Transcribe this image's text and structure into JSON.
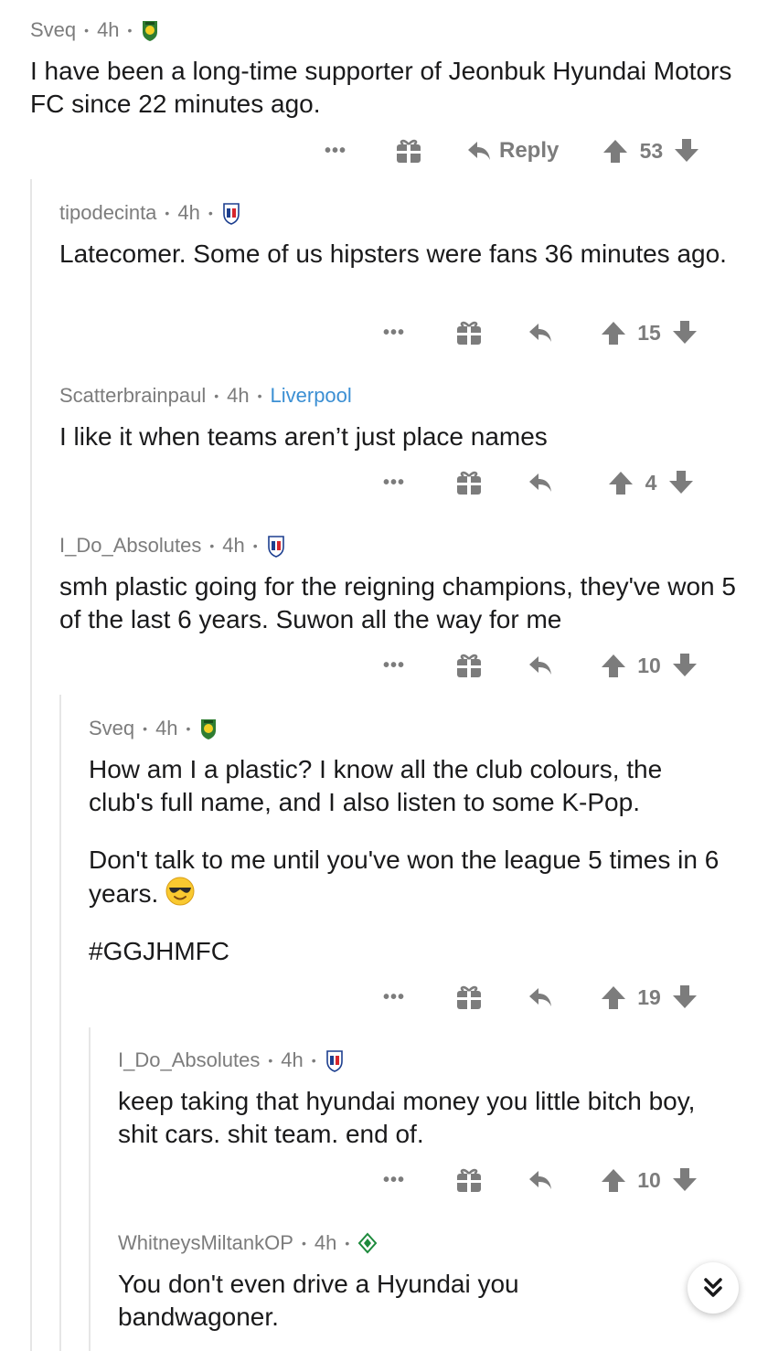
{
  "comments": [
    {
      "author": "Sveq",
      "age": "4h",
      "flair_icon": "jeonbuk-crest-icon",
      "body": [
        "I have been a long-time supporter of Jeonbuk Hyundai Motors FC since 22 minutes ago."
      ],
      "reply_label": "Reply",
      "score": "53"
    },
    {
      "author": "tipodecinta",
      "age": "4h",
      "flair_icon": "suwon-crest-icon",
      "body": [
        "Latecomer. Some of us hipsters were fans 36 minutes ago."
      ],
      "score": "15"
    },
    {
      "author": "Scatterbrainpaul",
      "age": "4h",
      "flair_text": "Liverpool",
      "body": [
        "I like it when teams aren’t just place names"
      ],
      "score": "4"
    },
    {
      "author": "I_Do_Absolutes",
      "age": "4h",
      "flair_icon": "suwon-crest-icon",
      "body": [
        "smh plastic going for the reigning champions, they've won 5 of the last 6 years. Suwon all the way for me"
      ],
      "score": "10"
    },
    {
      "author": "Sveq",
      "age": "4h",
      "flair_icon": "jeonbuk-crest-icon",
      "body": [
        "How am I a plastic? I know all the club colours, the club's full name, and I also listen to some K-Pop.",
        "Don't talk to me until you've won the league 5 times in 6 years.",
        "#GGJHMFC"
      ],
      "emoji": "sunglasses-emoji",
      "score": "19"
    },
    {
      "author": "I_Do_Absolutes",
      "age": "4h",
      "flair_icon": "suwon-crest-icon",
      "body": [
        "keep taking that hyundai money you little bitch boy, shit cars. shit team. end of."
      ],
      "score": "10"
    },
    {
      "author": "WhitneysMiltankOP",
      "age": "4h",
      "flair_icon": "werder-diamond-icon",
      "body": [
        "You don't even drive a Hyundai you bandwagoner."
      ]
    }
  ],
  "more_glyph": "•••",
  "meta_separator": "•",
  "scroll_icon": "double-chevron-down-icon"
}
